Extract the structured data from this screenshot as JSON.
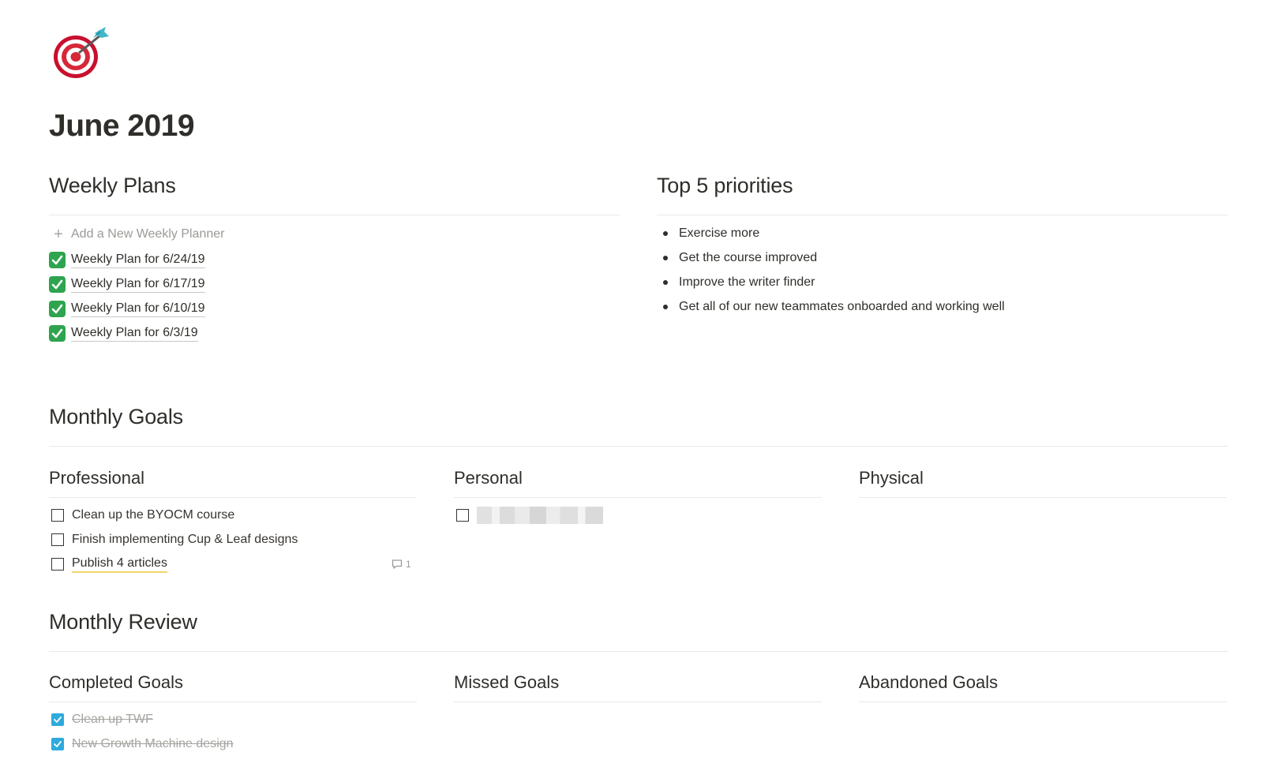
{
  "page": {
    "icon": "target-dart-icon",
    "title": "June 2019"
  },
  "weekly_plans": {
    "heading": "Weekly Plans",
    "add_label": "Add a New Weekly Planner",
    "items": [
      {
        "label": "Weekly Plan for 6/24/19",
        "icon": "check-mark-button-icon"
      },
      {
        "label": "Weekly Plan for 6/17/19",
        "icon": "check-mark-button-icon"
      },
      {
        "label": "Weekly Plan for 6/10/19",
        "icon": "check-mark-button-icon"
      },
      {
        "label": "Weekly Plan for 6/3/19",
        "icon": "check-mark-button-icon"
      }
    ]
  },
  "priorities": {
    "heading": "Top 5 priorities",
    "items": [
      "Exercise more",
      "Get the course improved",
      "Improve the writer finder",
      "Get all of our new teammates onboarded and working well"
    ]
  },
  "monthly_goals": {
    "heading": "Monthly Goals",
    "columns": [
      {
        "heading": "Professional",
        "items": [
          {
            "label": "Clean up the BYOCM course",
            "checked": false
          },
          {
            "label": "Finish implementing Cup & Leaf designs",
            "checked": false
          },
          {
            "label": "Publish 4 articles",
            "checked": false,
            "highlight": true,
            "comments": "1"
          }
        ]
      },
      {
        "heading": "Personal",
        "items": [
          {
            "label": "",
            "checked": false,
            "redacted": true
          }
        ]
      },
      {
        "heading": "Physical",
        "items": []
      }
    ]
  },
  "monthly_review": {
    "heading": "Monthly Review",
    "columns": [
      {
        "heading": "Completed Goals",
        "items": [
          {
            "label": "Clean up TWF",
            "checked": true
          },
          {
            "label": "New Growth Machine design",
            "checked": true
          }
        ]
      },
      {
        "heading": "Missed Goals",
        "items": []
      },
      {
        "heading": "Abandoned Goals",
        "items": []
      }
    ]
  },
  "colors": {
    "text": "#37352f",
    "divider": "#e9e9e7",
    "checked_box": "#2eaadc",
    "emoji_check": "#2ea44f",
    "highlight_underline": "#f5d66b"
  }
}
